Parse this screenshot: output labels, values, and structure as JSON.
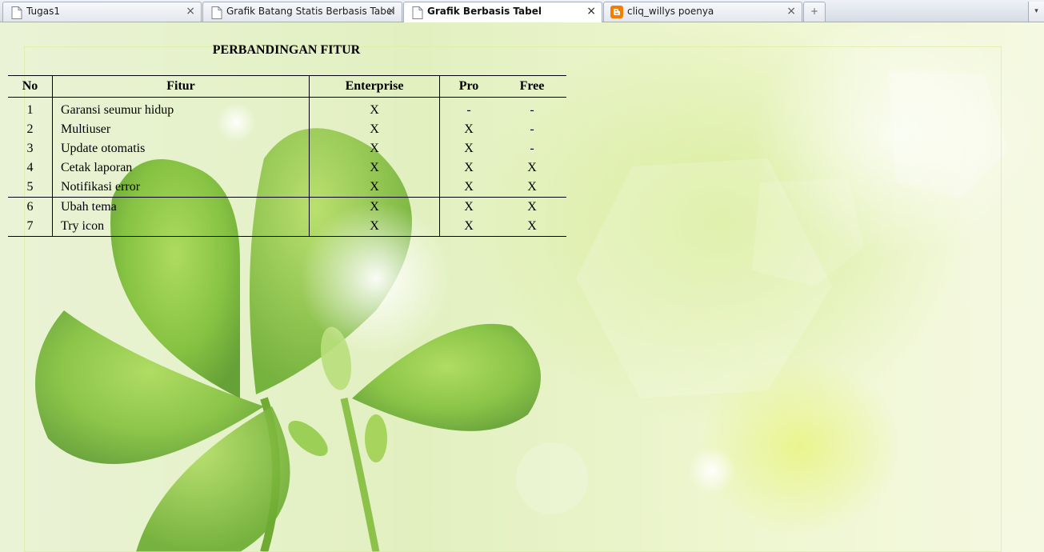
{
  "tabs": [
    {
      "label": "Tugas1",
      "icon": "page-icon",
      "active": false
    },
    {
      "label": "Grafik Batang Statis Berbasis Tabel",
      "icon": "page-icon",
      "active": false
    },
    {
      "label": "Grafik Berbasis Tabel",
      "icon": "page-icon",
      "active": true
    },
    {
      "label": "cliq_willys poenya",
      "icon": "blogger-icon",
      "active": false
    }
  ],
  "tab_close_glyph": "×",
  "new_tab_glyph": "+",
  "tab_menu_glyph": "▾",
  "page": {
    "title": "PERBANDINGAN FITUR",
    "table": {
      "headers": [
        "No",
        "Fitur",
        "Enterprise",
        "Pro",
        "Free"
      ],
      "rows": [
        [
          "1",
          "Garansi seumur hidup",
          "X",
          "-",
          "-"
        ],
        [
          "2",
          "Multiuser",
          "X",
          "X",
          "-"
        ],
        [
          "3",
          "Update otomatis",
          "X",
          "X",
          "-"
        ],
        [
          "4",
          "Cetak laporan",
          "X",
          "X",
          "X"
        ],
        [
          "5",
          "Notifikasi error",
          "X",
          "X",
          "X"
        ],
        [
          "6",
          "Ubah tema",
          "X",
          "X",
          "X"
        ],
        [
          "7",
          "Try icon",
          "X",
          "X",
          "X"
        ]
      ]
    }
  },
  "colors": {
    "leaf_dark": "#5a9a2a",
    "leaf_light": "#9fd04a",
    "blogger_orange": "#f57d00"
  }
}
